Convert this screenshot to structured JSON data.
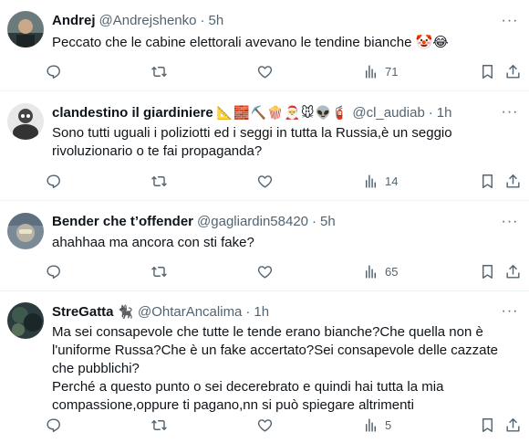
{
  "replies": [
    {
      "name": "Andrej",
      "handle": "@Andrejshenko",
      "dot": "·",
      "time": "5h",
      "emojis": "",
      "text": [
        "Peccato che le cabine elettorali avevano le tendine bianche 🤡😂"
      ],
      "views": "71",
      "avatar_icon": "avatar-andrej"
    },
    {
      "name": "clandestino il giardiniere",
      "handle": "@cl_audiab",
      "dot": "·",
      "time": "1h",
      "emojis": "📐🧱⛏️🍿🎅🐭👽🧯",
      "text": [
        "Sono tutti uguali i poliziotti ed i seggi in tutta la Russia,è un seggio",
        "rivoluzionario o te fai propaganda?"
      ],
      "views": "14",
      "avatar_icon": "avatar-clandestino"
    },
    {
      "name": "Bender che t’offender",
      "handle": "@gagliardin58420",
      "dot": "·",
      "time": "5h",
      "emojis": "",
      "text": [
        "ahahhaa ma ancora con sti fake?"
      ],
      "views": "65",
      "avatar_icon": "avatar-bender"
    },
    {
      "name": "StreGatta",
      "handle": "@OhtarAncalima",
      "dot": "·",
      "time": "1h",
      "emojis": "🐈‍⬛",
      "text": [
        "Ma sei consapevole che tutte le tende erano bianche?Che quella non è",
        "l'uniforme Russa?Che è un fake accertato?Sei consapevole delle cazzate",
        "che pubblichi?",
        "Perché a questo punto o sei decerebrato e quindi hai tutta la mia",
        "compassione,oppure ti pagano,nn si può spiegare altrimenti"
      ],
      "views": "5",
      "avatar_icon": "avatar-stregatta"
    }
  ],
  "icons": {
    "more": "more-icon",
    "reply": "reply-icon",
    "retweet": "retweet-icon",
    "like": "like-icon",
    "views": "views-icon",
    "bookmark": "bookmark-icon",
    "share": "share-icon"
  },
  "colors": {
    "text": "#0f1419",
    "secondary": "#536471",
    "divider": "#eff3f4"
  }
}
